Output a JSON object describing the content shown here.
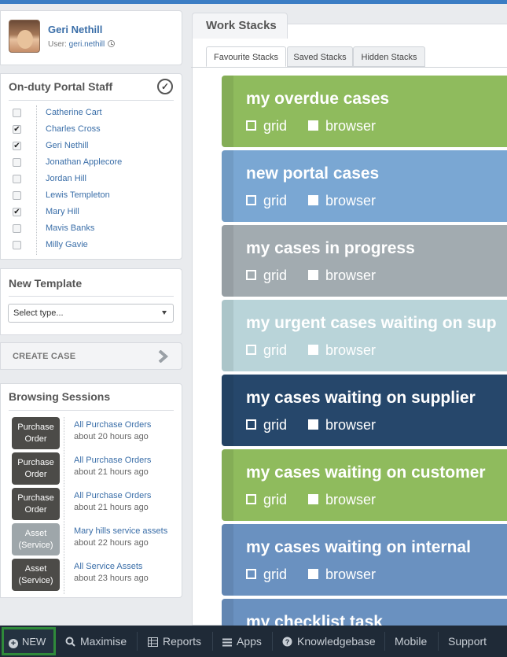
{
  "user": {
    "name": "Geri Nethill",
    "user_prefix": "User: ",
    "username": "geri.nethill"
  },
  "staff": {
    "title": "On-duty Portal Staff",
    "members": [
      {
        "name": "Catherine Cart",
        "checked": ""
      },
      {
        "name": "Charles Cross",
        "checked": "✔"
      },
      {
        "name": "Geri Nethill",
        "checked": "✔"
      },
      {
        "name": "Jonathan Applecore",
        "checked": ""
      },
      {
        "name": "Jordan Hill",
        "checked": ""
      },
      {
        "name": "Lewis Templeton",
        "checked": ""
      },
      {
        "name": "Mary Hill",
        "checked": "✔"
      },
      {
        "name": "Mavis Banks",
        "checked": ""
      },
      {
        "name": "Milly Gavie",
        "checked": ""
      }
    ]
  },
  "template": {
    "title": "New Template",
    "select_value": "Select type..."
  },
  "create_case": {
    "label": "CREATE CASE"
  },
  "sessions": {
    "title": "Browsing Sessions",
    "items": [
      {
        "badge1": "Purchase",
        "badge2": "Order",
        "link": "All Purchase Orders",
        "time": "about 20 hours ago"
      },
      {
        "badge1": "Purchase",
        "badge2": "Order",
        "link": "All Purchase Orders",
        "time": "about 21 hours ago"
      },
      {
        "badge1": "Purchase",
        "badge2": "Order",
        "link": "All Purchase Orders",
        "time": "about 21 hours ago"
      },
      {
        "badge1": "Asset",
        "badge2": "(Service)",
        "link": "Mary hills service assets",
        "time": "about 22 hours ago"
      },
      {
        "badge1": "Asset",
        "badge2": "(Service)",
        "link": "All Service Assets",
        "time": "about 23 hours ago"
      }
    ]
  },
  "workstacks": {
    "title": "Work Stacks",
    "tabs": [
      "Favourite Stacks",
      "Saved Stacks",
      "Hidden Stacks"
    ],
    "active_tab": "Favourite Stacks",
    "grid_label": "grid",
    "browser_label": "browser",
    "stacks": [
      {
        "title": "my overdue cases",
        "color": "#8fbb5d"
      },
      {
        "title": "new portal cases",
        "color": "#7aa7d3"
      },
      {
        "title": "my cases in progress",
        "color": "#a2abb0"
      },
      {
        "title": "my urgent cases waiting on sup",
        "color": "#b9d4d9"
      },
      {
        "title": "my cases waiting on supplier",
        "color": "#26476b"
      },
      {
        "title": "my cases waiting on customer",
        "color": "#8fbb5d"
      },
      {
        "title": "my cases waiting on internal",
        "color": "#6a91c0"
      },
      {
        "title": "my checklist task",
        "color": "#6a91c0"
      }
    ]
  },
  "bottombar": {
    "new_label": "NEW",
    "items": [
      "Maximise",
      "Reports",
      "Apps",
      "Knowledgebase",
      "Mobile",
      "Support"
    ]
  }
}
